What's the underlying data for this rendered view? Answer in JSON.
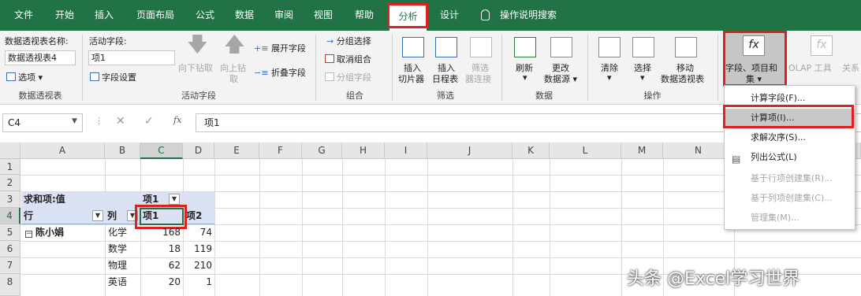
{
  "tabs": {
    "file": "文件",
    "home": "开始",
    "insert": "插入",
    "layout": "页面布局",
    "formula": "公式",
    "data": "数据",
    "review": "审阅",
    "view": "视图",
    "help": "帮助",
    "analyze": "分析",
    "design": "设计"
  },
  "tell_me": "操作说明搜索",
  "ribbon": {
    "pivot_name_label": "数据透视表名称:",
    "pivot_name_value": "数据透视表4",
    "options": "选项",
    "group_pivot": "数据透视表",
    "active_field_label": "活动字段:",
    "active_field_value": "项1",
    "field_settings": "字段设置",
    "drill_down": "向下钻取",
    "drill_up_1": "向上钻",
    "drill_up_2": "取",
    "expand_field": "展开字段",
    "collapse_field": "折叠字段",
    "group_active_field": "活动字段",
    "group_selection": "分组选择",
    "ungroup": "取消组合",
    "group_field": "分组字段",
    "group_group": "组合",
    "insert_slicer_1": "插入",
    "insert_slicer_2": "切片器",
    "insert_timeline_1": "插入",
    "insert_timeline_2": "日程表",
    "filter_conn_1": "筛选",
    "filter_conn_2": "器连接",
    "group_filter": "筛选",
    "refresh": "刷新",
    "change_source_1": "更改",
    "change_source_2": "数据源",
    "group_data": "数据",
    "clear": "清除",
    "select": "选择",
    "move_pivot_1": "移动",
    "move_pivot_2": "数据透视表",
    "group_actions": "操作",
    "fields_items_1": "字段、项目和",
    "fields_items_2": "集",
    "olap_tools": "OLAP 工具",
    "relationships": "关系"
  },
  "formula_bar": {
    "name_box": "C4",
    "fx": "fx",
    "content": "项1"
  },
  "columns": [
    "A",
    "B",
    "C",
    "D",
    "E",
    "F",
    "G",
    "H",
    "I",
    "J",
    "K",
    "L",
    "M",
    "N"
  ],
  "rows": [
    "1",
    "2",
    "3",
    "4",
    "5",
    "6",
    "7",
    "8"
  ],
  "pivot": {
    "sum_label": "求和项:值",
    "col_field": "项1",
    "row_label": "行",
    "col_label": "列",
    "item1": "项1",
    "item2": "项2",
    "person": "陈小娟",
    "subjects": [
      "化学",
      "数学",
      "物理",
      "英语"
    ],
    "c_values": [
      "168",
      "18",
      "62",
      "20"
    ],
    "d_values": [
      "74",
      "119",
      "210",
      "1"
    ]
  },
  "menu": {
    "calc_field": "计算字段(F)...",
    "calc_item": "计算项(I)...",
    "solve_order": "求解次序(S)...",
    "list_formulas": "列出公式(L)",
    "row_sets": "基于行项创建集(R)...",
    "col_sets": "基于列项创建集(C)...",
    "manage_sets": "管理集(M)..."
  },
  "watermark": "头条 @Excel学习世界",
  "colors": {
    "excel_green": "#217346",
    "highlight_red": "#e02020",
    "pivot_blue": "#d9e1f2"
  }
}
